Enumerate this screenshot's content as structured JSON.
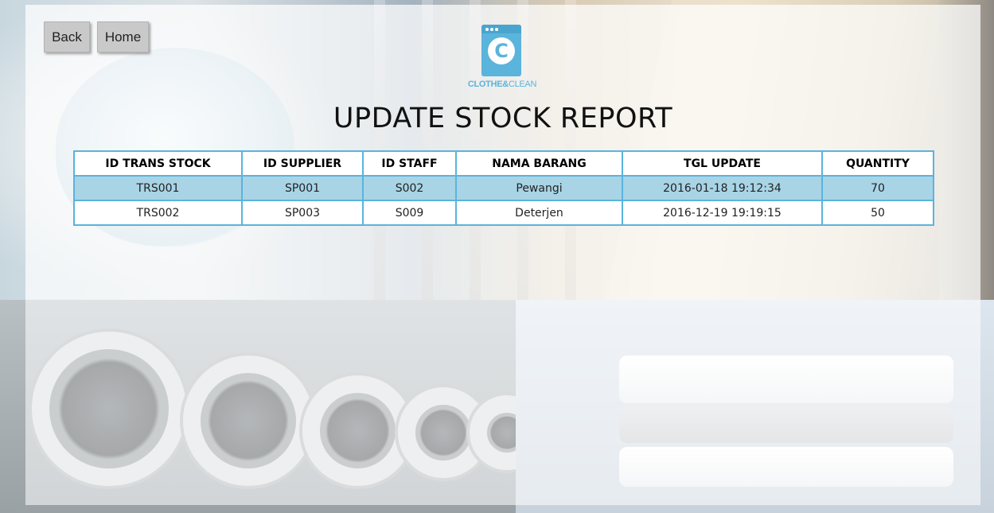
{
  "nav": {
    "back_label": "Back",
    "home_label": "Home"
  },
  "logo": {
    "icon": "washing-machine-icon",
    "brand_bold": "CLOTHE&",
    "brand_light": "CLEAN",
    "letter": "C"
  },
  "page": {
    "title": "UPDATE STOCK REPORT"
  },
  "table": {
    "columns": [
      "ID TRANS STOCK",
      "ID SUPPLIER",
      "ID STAFF",
      "NAMA BARANG",
      "TGL UPDATE",
      "QUANTITY"
    ],
    "rows": [
      [
        "TRS001",
        "SP001",
        "S002",
        "Pewangi",
        "2016-01-18 19:12:34",
        "70"
      ],
      [
        "TRS002",
        "SP003",
        "S009",
        "Deterjen",
        "2016-12-19 19:19:15",
        "50"
      ]
    ]
  },
  "colors": {
    "accent": "#5ab4dc",
    "row_highlight": "#a8d4e6",
    "button_bg": "#c9c9c9"
  }
}
